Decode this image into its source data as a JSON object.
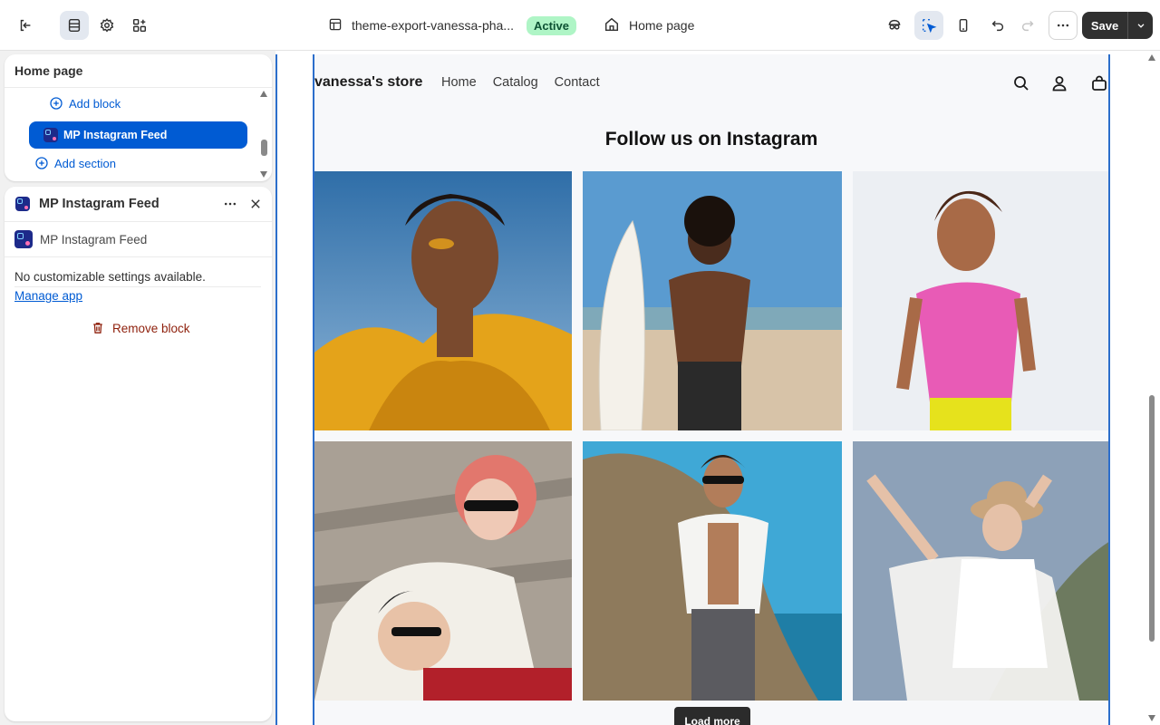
{
  "topbar": {
    "theme_name": "theme-export-vanessa-pha...",
    "status_badge": "Active",
    "page_name": "Home page",
    "save_label": "Save"
  },
  "sidebar": {
    "tree": {
      "title": "Home page",
      "add_block": "Add block",
      "selected_block": "MP Instagram Feed",
      "add_section": "Add section"
    },
    "settings": {
      "title": "MP Instagram Feed",
      "app_name": "MP Instagram Feed",
      "empty_message": "No customizable settings available.",
      "manage_link": "Manage app",
      "remove_label": "Remove block"
    }
  },
  "preview": {
    "store_name": "vanessa's store",
    "nav": [
      "Home",
      "Catalog",
      "Contact"
    ],
    "section_title": "Follow us on Instagram",
    "load_more": "Load more",
    "photos": [
      {
        "name": "instagram-photo-woman-yellow-scarf"
      },
      {
        "name": "instagram-photo-man-surfboard"
      },
      {
        "name": "instagram-photo-woman-pink-top"
      },
      {
        "name": "instagram-photo-couple-sunglasses"
      },
      {
        "name": "instagram-photo-man-white-shirt-rock"
      },
      {
        "name": "instagram-photo-woman-white-dress-hat"
      }
    ]
  },
  "colors": {
    "accent": "#005bd3",
    "selection_outline": "#2c6ecb",
    "badge_bg": "#aff5c6",
    "badge_text": "#0c5132",
    "danger": "#8e1f0b",
    "save_bg": "#303030"
  }
}
